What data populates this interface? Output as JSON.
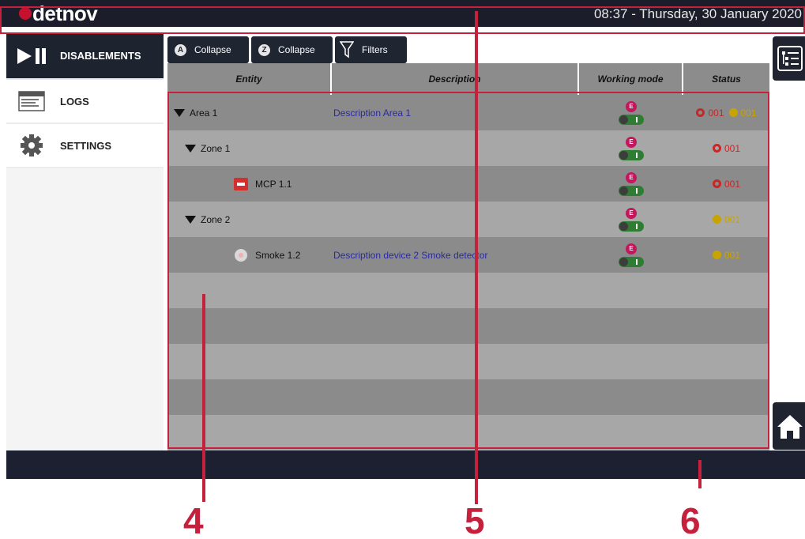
{
  "topbar": {
    "brand": "detnov",
    "clock": "08:37  -  Thursday, 30 January 2020"
  },
  "sidebar": {
    "items": [
      {
        "label": "DISABLEMENTS",
        "icon": "play-pause-icon",
        "active": true
      },
      {
        "label": "LOGS",
        "icon": "logs-window-icon",
        "active": false
      },
      {
        "label": "SETTINGS",
        "icon": "gear-icon",
        "active": false
      }
    ]
  },
  "toolbar": {
    "collapse_a_badge": "A",
    "collapse_a_label": "Collapse",
    "collapse_z_badge": "Z",
    "collapse_z_label": "Collapse",
    "filters_label": "Filters"
  },
  "table": {
    "headers": [
      "Entity",
      "Description",
      "Working mode",
      "Status"
    ],
    "rows": [
      {
        "entity": "Area 1",
        "level": 0,
        "expandable": true,
        "icon": "",
        "description": "Description Area 1",
        "mode_badge": "E",
        "status_fire": "001",
        "status_fault": "001"
      },
      {
        "entity": "Zone 1",
        "level": 1,
        "expandable": true,
        "icon": "",
        "description": "",
        "mode_badge": "E",
        "status_fire": "001",
        "status_fault": ""
      },
      {
        "entity": "MCP 1.1",
        "level": 2,
        "expandable": false,
        "icon": "mcp-device-icon",
        "description": "",
        "mode_badge": "E",
        "status_fire": "001",
        "status_fault": ""
      },
      {
        "entity": "Zone 2",
        "level": 1,
        "expandable": true,
        "icon": "",
        "description": "",
        "mode_badge": "E",
        "status_fire": "",
        "status_fault": "001"
      },
      {
        "entity": "Smoke 1.2",
        "level": 2,
        "expandable": false,
        "icon": "smoke-detector-icon",
        "description": "Description device 2 Smoke detector",
        "mode_badge": "E",
        "status_fire": "",
        "status_fault": "001"
      }
    ],
    "empty_rows": 5
  },
  "callouts": [
    "4",
    "5",
    "6"
  ],
  "colors": {
    "accent": "#c5203c",
    "dark_bar": "#1b1e2a",
    "fire": "#c62828",
    "fault": "#c9a400",
    "mode_enabled": "#2e7d32",
    "mode_badge": "#c2185b",
    "description_text": "#2a2aa0"
  }
}
